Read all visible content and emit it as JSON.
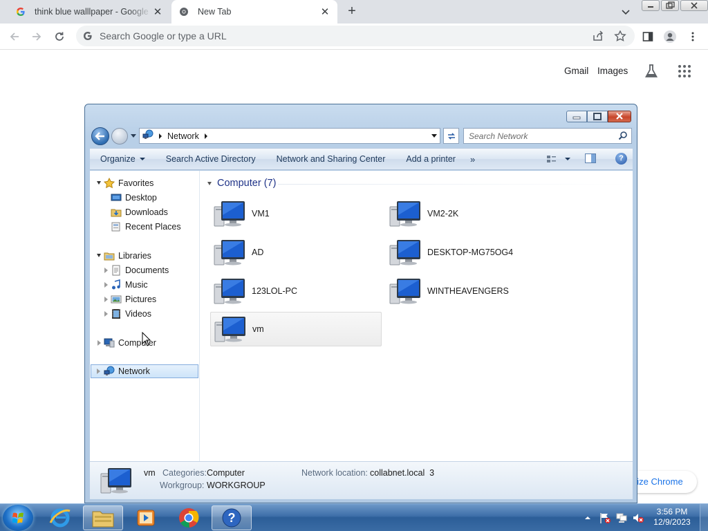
{
  "chrome": {
    "tabs": [
      {
        "title": "think blue walllpaper - Google S",
        "favicon": "google-g-icon",
        "active": false
      },
      {
        "title": "New Tab",
        "favicon": "chrome-icon",
        "active": true
      }
    ],
    "omnibox_placeholder": "Search Google or type a URL"
  },
  "ntp": {
    "gmail": "Gmail",
    "images": "Images",
    "customize": "nize Chrome"
  },
  "explorer": {
    "breadcrumb": "Network",
    "search_placeholder": "Search Network",
    "commands": [
      {
        "label": "Organize",
        "dropdown": true
      },
      {
        "label": "Search Active Directory",
        "dropdown": false
      },
      {
        "label": "Network and Sharing Center",
        "dropdown": false
      },
      {
        "label": "Add a printer",
        "dropdown": false
      }
    ],
    "more": "»",
    "help": "?",
    "nav": {
      "favorites": "Favorites",
      "desktop": "Desktop",
      "downloads": "Downloads",
      "recent_places": "Recent Places",
      "libraries": "Libraries",
      "documents": "Documents",
      "music": "Music",
      "pictures": "Pictures",
      "videos": "Videos",
      "computer": "Computer",
      "network": "Network"
    },
    "group_header": "Computer (7)",
    "computers": [
      "VM1",
      "VM2-2K",
      "AD",
      "DESKTOP-MG75OG4",
      "123LOL-PC",
      "WINTHEAVENGERS",
      "vm"
    ],
    "selected": "vm",
    "details": {
      "name": "vm",
      "categories_label": "Categories:",
      "categories_value": "Computer",
      "workgroup_label": "Workgroup:",
      "workgroup_value": "WORKGROUP",
      "location_label": "Network location:",
      "location_value": "collabnet.local  3"
    }
  },
  "taskbar": {
    "apps": [
      "start-orb",
      "internet-explorer-icon",
      "windows-explorer-icon",
      "media-player-icon",
      "chrome-icon",
      "help-support-icon"
    ],
    "time": "3:56 PM",
    "date": "12/9/2023"
  },
  "colors": {
    "chrome_tabstrip": "#dee1e6",
    "explorer_frame": "#b8cfe7",
    "group_header": "#1e3287",
    "taskbar": "#3d6ea8",
    "google_blue": "#1a73e8"
  }
}
